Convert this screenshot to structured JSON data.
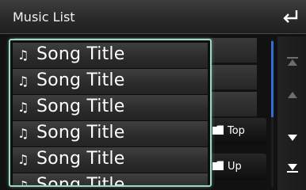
{
  "header": {
    "title": "Music List",
    "back_icon": "return-arrow-icon"
  },
  "list": {
    "note_glyph": "♫",
    "items": [
      {
        "label": "Song Title"
      },
      {
        "label": "Song Title"
      },
      {
        "label": "Song Title"
      },
      {
        "label": "Song Title"
      },
      {
        "label": "Song Title"
      },
      {
        "label": "Song Title"
      }
    ]
  },
  "side_buttons": {
    "top_label": "Top",
    "up_label": "Up",
    "folder_icon": "folder-icon"
  },
  "navigation": {
    "icons": [
      "scroll-to-top-icon",
      "page-up-icon",
      "page-down-icon",
      "scroll-to-bottom-icon"
    ]
  },
  "colors": {
    "popup_border": "#9bd9c6",
    "scroll_thumb": "#2f6fd6"
  }
}
